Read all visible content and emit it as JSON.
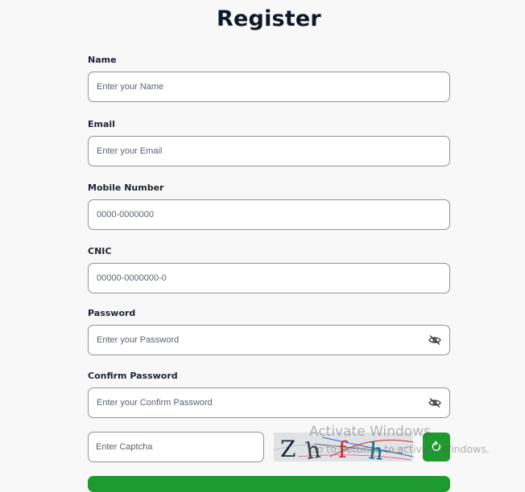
{
  "page": {
    "title": "Register"
  },
  "form": {
    "name": {
      "label": "Name",
      "placeholder": "Enter your Name"
    },
    "email": {
      "label": "Email",
      "placeholder": "Enter your Email"
    },
    "mobile": {
      "label": "Mobile Number",
      "placeholder": "0000-0000000"
    },
    "cnic": {
      "label": "CNIC",
      "placeholder": "00000-0000000-0"
    },
    "password": {
      "label": "Password",
      "placeholder": "Enter your Password",
      "icon": "eye-off-icon"
    },
    "confirm_password": {
      "label": "Confirm Password",
      "placeholder": "Enter your Confirm Password",
      "icon": "eye-off-icon"
    },
    "captcha": {
      "placeholder": "Enter Captcha",
      "image_text": "Z h f h",
      "refresh_icon": "refresh-icon"
    }
  },
  "watermark": {
    "title": "Activate Windows",
    "subtitle": "Go to Settings to activate Windows."
  },
  "colors": {
    "background": "#f8f8f8",
    "accent": "#1f9a2e",
    "border": "#8e939b",
    "title": "#101828"
  }
}
